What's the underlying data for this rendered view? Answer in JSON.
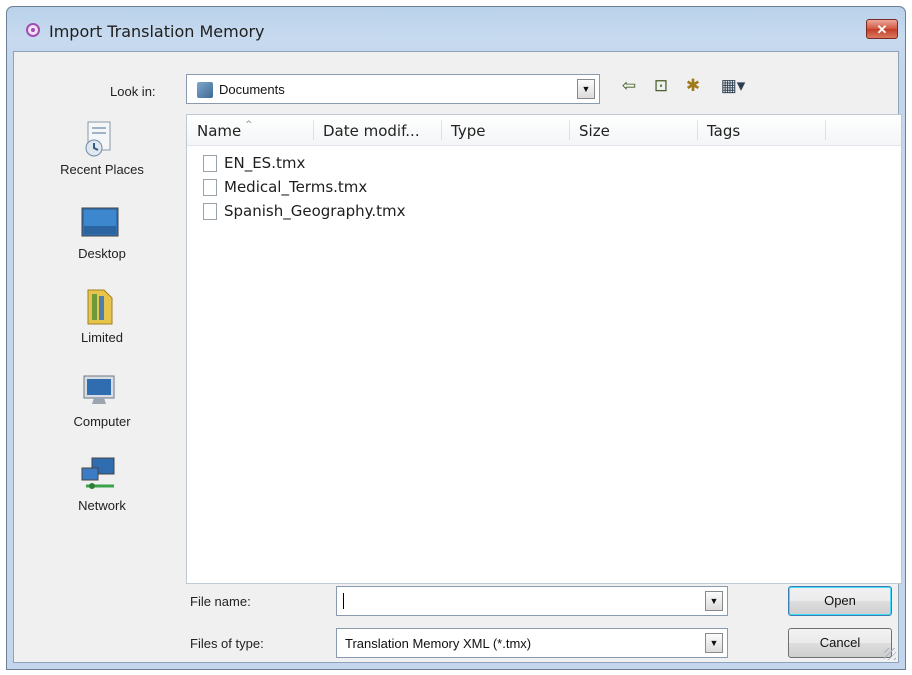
{
  "window": {
    "title": "Import Translation Memory",
    "close_label": "✕"
  },
  "lookin": {
    "label": "Look in:",
    "value": "Documents"
  },
  "places": [
    {
      "label": "Recent Places",
      "icon": "recent-places-icon"
    },
    {
      "label": "Desktop",
      "icon": "desktop-icon"
    },
    {
      "label": "Limited",
      "icon": "user-folder-icon"
    },
    {
      "label": "Computer",
      "icon": "computer-icon"
    },
    {
      "label": "Network",
      "icon": "network-icon"
    }
  ],
  "columns": [
    "Name",
    "Date modif...",
    "Type",
    "Size",
    "Tags"
  ],
  "files": [
    {
      "name": "EN_ES.tmx"
    },
    {
      "name": "Medical_Terms.tmx"
    },
    {
      "name": "Spanish_Geography.tmx"
    }
  ],
  "filename": {
    "label": "File name:",
    "value": ""
  },
  "filetype": {
    "label": "Files of type:",
    "value": "Translation Memory XML (*.tmx)"
  },
  "buttons": {
    "open": "Open",
    "cancel": "Cancel"
  },
  "toolbar": {
    "back_glyph": "⇦",
    "up_glyph": "⊡",
    "new_folder_glyph": "✱",
    "views_glyph": "▦▾"
  },
  "colors": {
    "accent": "#a04fb3",
    "close": "#c23d27",
    "frame": "#c3d6ec"
  }
}
